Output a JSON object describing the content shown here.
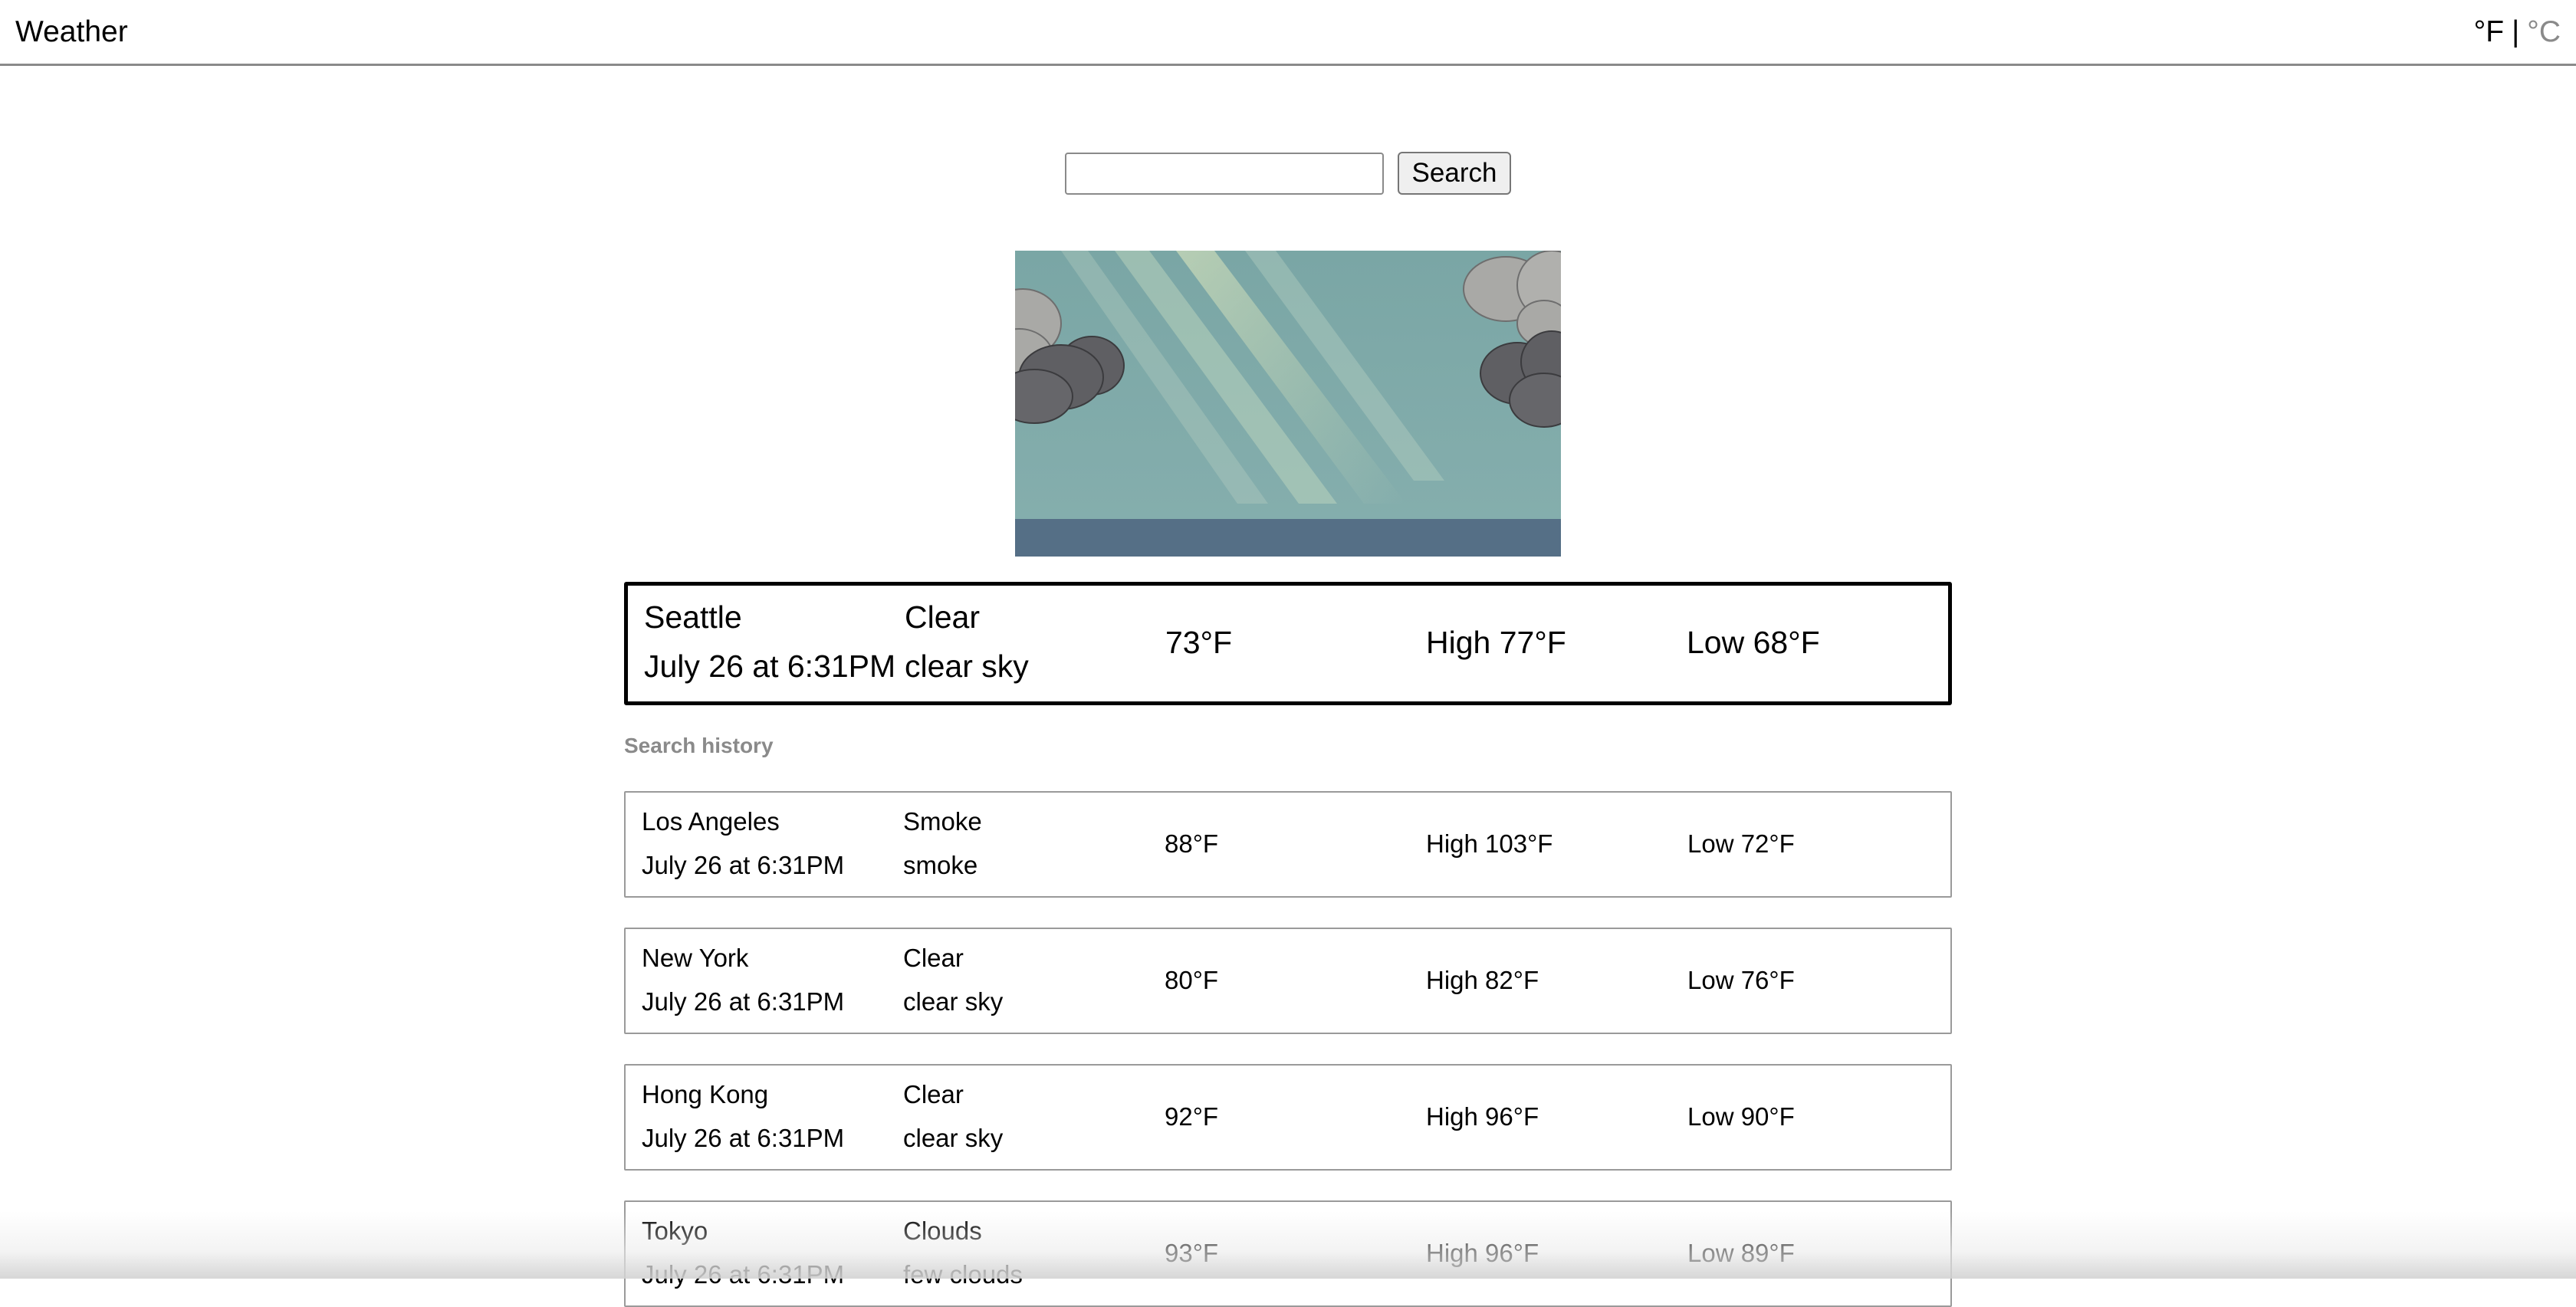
{
  "header": {
    "title": "Weather",
    "unit_f": "°F",
    "unit_separator": "|",
    "unit_c": "°C"
  },
  "search": {
    "input_value": "",
    "button_label": "Search"
  },
  "current": {
    "city": "Seattle",
    "datetime": "July 26 at 6:31PM",
    "condition": "Clear",
    "description": "clear sky",
    "temp": "73°F",
    "high": "High 77°F",
    "low": "Low 68°F"
  },
  "history": {
    "label": "Search history",
    "items": [
      {
        "city": "Los Angeles",
        "datetime": "July 26 at 6:31PM",
        "condition": "Smoke",
        "description": "smoke",
        "temp": "88°F",
        "high": "High 103°F",
        "low": "Low 72°F"
      },
      {
        "city": "New York",
        "datetime": "July 26 at 6:31PM",
        "condition": "Clear",
        "description": "clear sky",
        "temp": "80°F",
        "high": "High 82°F",
        "low": "Low 76°F"
      },
      {
        "city": "Hong Kong",
        "datetime": "July 26 at 6:31PM",
        "condition": "Clear",
        "description": "clear sky",
        "temp": "92°F",
        "high": "High 96°F",
        "low": "Low 90°F"
      },
      {
        "city": "Tokyo",
        "datetime": "July 26 at 6:31PM",
        "condition": "Clouds",
        "description": "few clouds",
        "temp": "93°F",
        "high": "High 96°F",
        "low": "Low 89°F"
      }
    ]
  },
  "colors": {
    "sky": "#7fa8a8",
    "ground": "#556f86",
    "cloud_dark": "#5f5f63",
    "cloud_light": "#a9a9a6",
    "muted_text": "#8a8a8a"
  }
}
